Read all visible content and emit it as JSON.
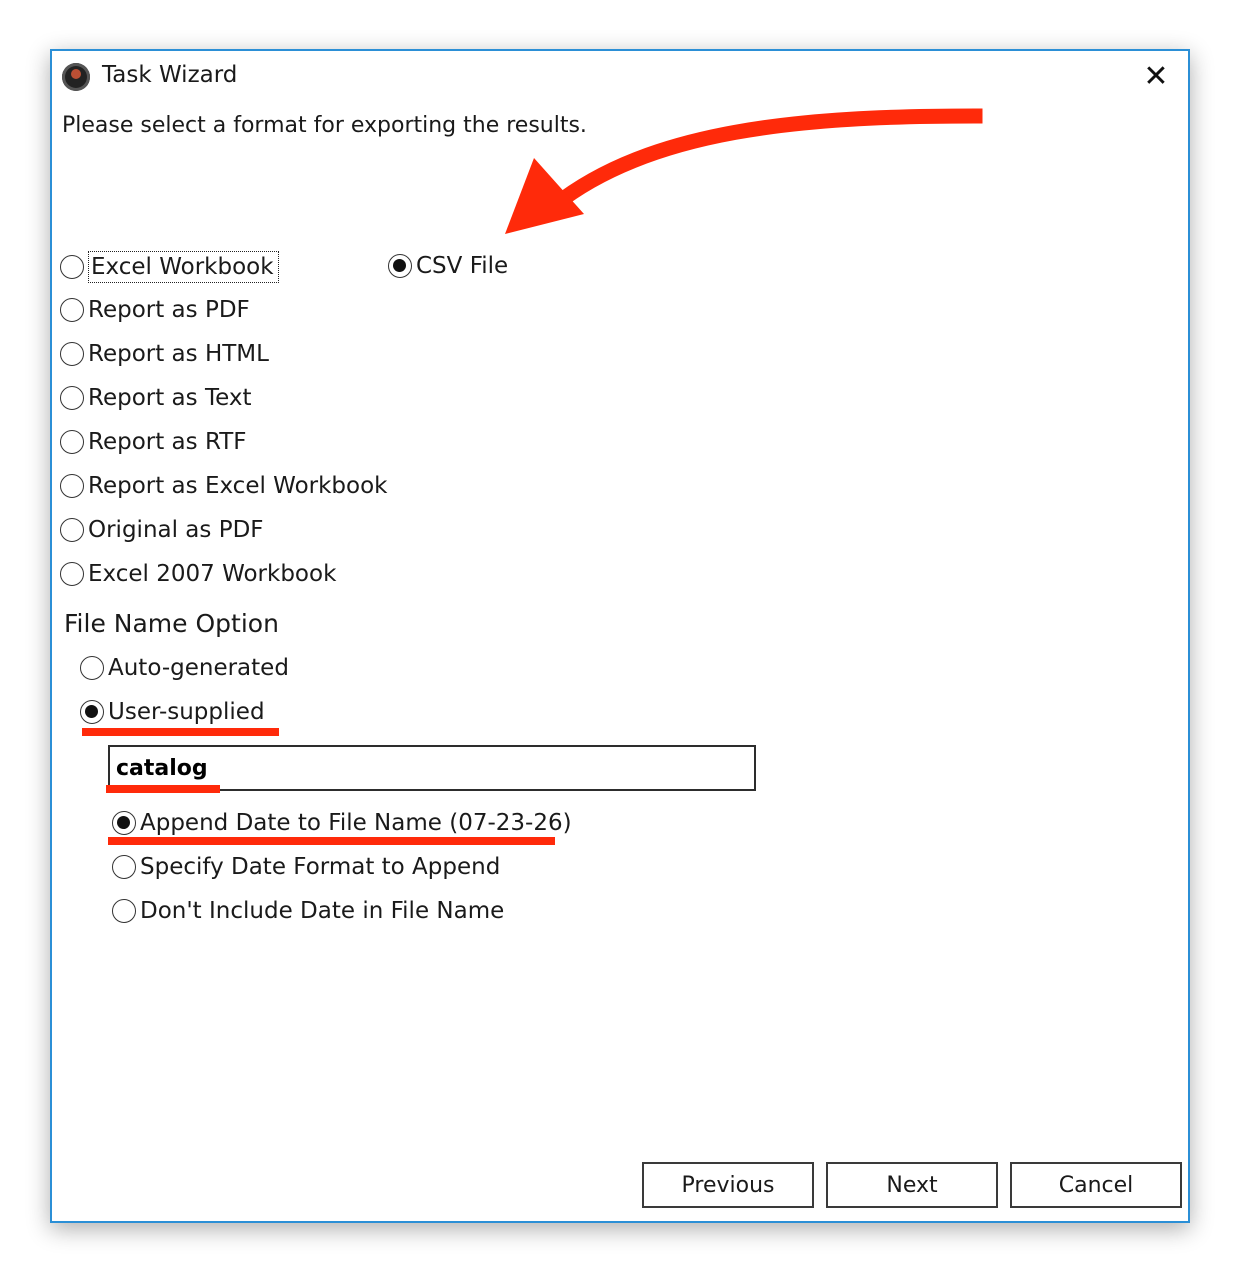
{
  "window": {
    "title": "Task Wizard",
    "close_glyph": "✕"
  },
  "instruction": "Please select a format for exporting the results.",
  "formats": [
    {
      "label": "Excel Workbook",
      "checked": false
    },
    {
      "label": "Report as PDF",
      "checked": false
    },
    {
      "label": "Report as HTML",
      "checked": false
    },
    {
      "label": "Report as Text",
      "checked": false
    },
    {
      "label": "Report as RTF",
      "checked": false
    },
    {
      "label": "Report as Excel Workbook",
      "checked": false
    },
    {
      "label": "Original as PDF",
      "checked": false
    },
    {
      "label": "Excel 2007 Workbook",
      "checked": false
    },
    {
      "label": "CSV File",
      "checked": true
    }
  ],
  "file_name_option": {
    "title": "File Name Option",
    "auto_label": "Auto-generated",
    "user_label": "User-supplied",
    "selected": "User-supplied",
    "file_name_value": "catalog",
    "date_options": [
      {
        "label": "Append Date to File Name (07-23-26)",
        "checked": true
      },
      {
        "label": "Specify Date Format to Append",
        "checked": false
      },
      {
        "label": "Don't Include Date in File Name",
        "checked": false
      }
    ]
  },
  "buttons": {
    "previous": "Previous",
    "next": "Next",
    "cancel": "Cancel"
  },
  "colors": {
    "window_border": "#2b8fd6",
    "annotation": "#ff2a0a"
  },
  "icons": {
    "app": "app-globe-icon",
    "close": "close-icon",
    "annotation_arrow": "red-arrow-annotation"
  }
}
